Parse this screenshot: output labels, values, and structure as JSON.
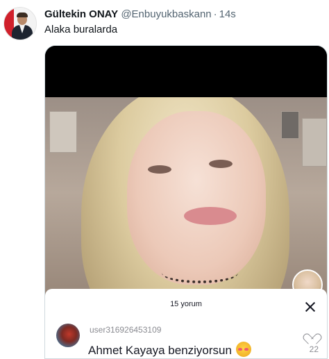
{
  "tweet": {
    "author_name": "Gültekin ONAY",
    "author_handle": "@Enbuyukbaskann",
    "separator": "·",
    "time": "14s",
    "text": "Alaka buralarda"
  },
  "media": {
    "comments_panel": {
      "count_label": "15 yorum",
      "comment": {
        "username": "user316926453109",
        "text": "Ahmet Kayaya benziyorsun",
        "emoji": "smiling-face-with-hearts",
        "like_count": "22"
      }
    },
    "colors": {
      "follow_accent": "#fe2c55",
      "handle_gray": "#536471"
    }
  }
}
